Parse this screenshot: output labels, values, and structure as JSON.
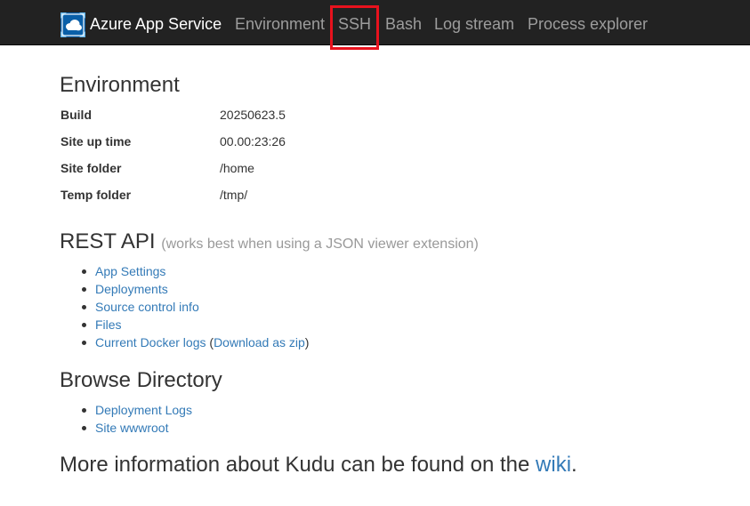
{
  "navbar": {
    "brand": "Azure App Service",
    "logo_icon": "azure-app-service-icon",
    "links": [
      "Environment",
      "SSH",
      "Bash",
      "Log stream",
      "Process explorer"
    ],
    "highlight_color": "#e8121d"
  },
  "environment": {
    "heading": "Environment",
    "rows": [
      {
        "key": "Build",
        "value": "20250623.5"
      },
      {
        "key": "Site up time",
        "value": "00.00:23:26"
      },
      {
        "key": "Site folder",
        "value": "/home"
      },
      {
        "key": "Temp folder",
        "value": "/tmp/"
      }
    ]
  },
  "rest_api": {
    "heading": "REST API",
    "subheading": "(works best when using a JSON viewer extension)",
    "links": [
      "App Settings",
      "Deployments",
      "Source control info",
      "Files",
      "Current Docker logs"
    ],
    "docker_prefix": "(",
    "docker_download": "Download as zip",
    "docker_suffix": ")"
  },
  "browse_directory": {
    "heading": "Browse Directory",
    "links": [
      "Deployment Logs",
      "Site wwwroot"
    ]
  },
  "more_info": {
    "text": "More information about Kudu can be found on the ",
    "link": "wiki",
    "suffix": "."
  },
  "colors": {
    "navbar_bg": "#222222",
    "nav_link": "#9d9d9d",
    "link": "#337ab7",
    "text": "#333333"
  }
}
